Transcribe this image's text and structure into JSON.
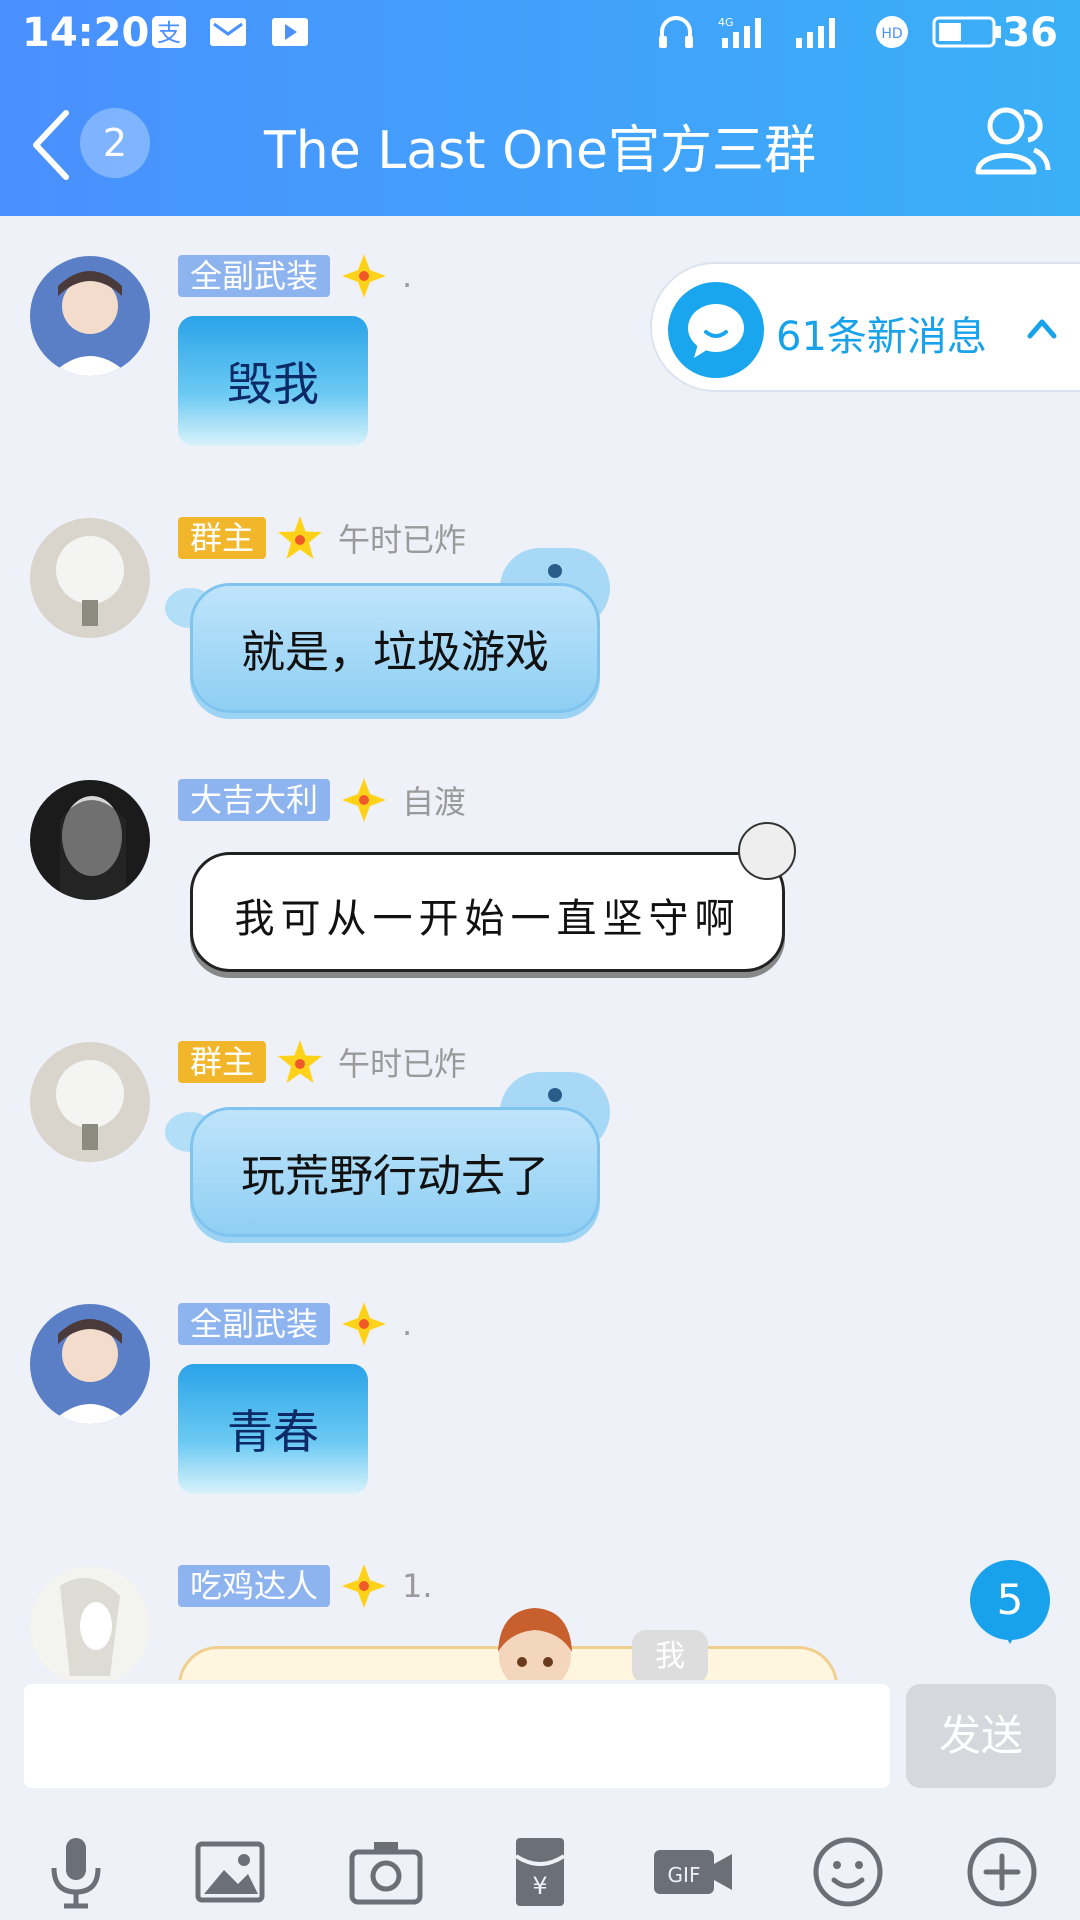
{
  "status_bar": {
    "time": "14:20",
    "network": "4G",
    "battery": "36"
  },
  "nav": {
    "unread_count": "2",
    "title": "The Last One官方三群"
  },
  "new_messages": {
    "label": "61条新消息"
  },
  "messages": [
    {
      "tag": "全副武装",
      "tag_color": "#8eb4ef",
      "nickname": ".",
      "sticker_text": "毁我"
    },
    {
      "tag": "群主",
      "tag_color": "#f2b62b",
      "nickname": "午时已炸",
      "text": "就是，垃圾游戏"
    },
    {
      "tag": "大吉大利",
      "tag_color": "#8eb4ef",
      "nickname": "自渡",
      "text": "我可从一开始一直坚守啊"
    },
    {
      "tag": "群主",
      "tag_color": "#f2b62b",
      "nickname": "午时已炸",
      "text": "玩荒野行动去了"
    },
    {
      "tag": "全副武装",
      "tag_color": "#8eb4ef",
      "nickname": ".",
      "sticker_text": "青春"
    },
    {
      "tag": "吃鸡达人",
      "tag_color": "#8eb4ef",
      "nickname": "1."
    }
  ],
  "floating": {
    "me_label": "我",
    "badge_count": "5"
  },
  "input": {
    "placeholder": "",
    "send_label": "发送"
  },
  "toolbar_icons": [
    "microphone-icon",
    "image-icon",
    "camera-icon",
    "red-packet-icon",
    "gif-icon",
    "emoji-icon",
    "plus-icon"
  ],
  "colors": {
    "header_start": "#4a90ff",
    "header_end": "#3ab0f7",
    "accent": "#18a2ec"
  }
}
